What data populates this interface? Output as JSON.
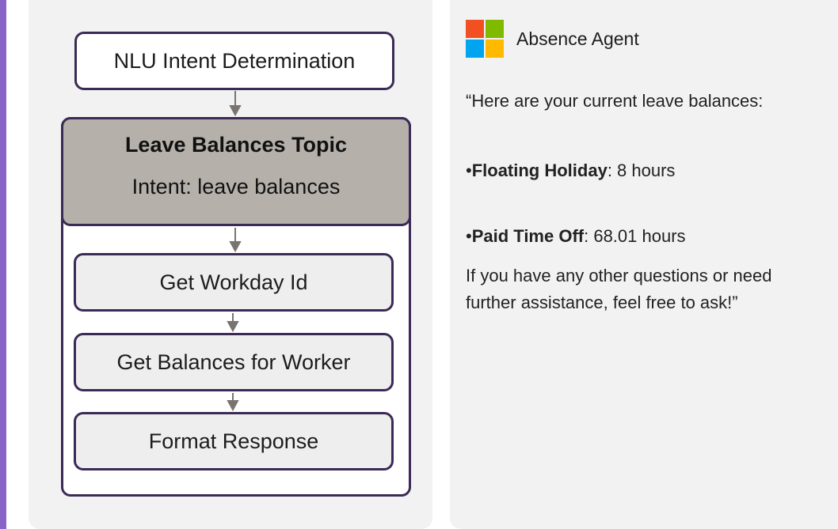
{
  "diagram": {
    "nlu_box": "NLU Intent Determination",
    "topic": {
      "title": "Leave Balances Topic",
      "subtitle": "Intent: leave balances"
    },
    "steps": [
      "Get Workday Id",
      "Get Balances for Worker",
      "Format Response"
    ]
  },
  "agent": {
    "name": "Absence Agent",
    "logo_colors": [
      "#f25022",
      "#7fba00",
      "#00a4ef",
      "#ffb900"
    ],
    "icon": "microsoft-logo-icon"
  },
  "message": {
    "intro": "“Here are your current leave balances:",
    "items": [
      {
        "bullet": "•",
        "label": "Floating Holiday",
        "value": ": 8 hours"
      },
      {
        "bullet": "•",
        "label": "Paid Time Off",
        "value": ": 68.01 hours"
      }
    ],
    "closing": "If you have any other questions or need further assistance, feel free to ask!”"
  },
  "colors": {
    "accent": "#8a63c9",
    "box_border": "#3b2a55",
    "topic_header": "#b5b0aa",
    "arrow": "#7a7470"
  }
}
